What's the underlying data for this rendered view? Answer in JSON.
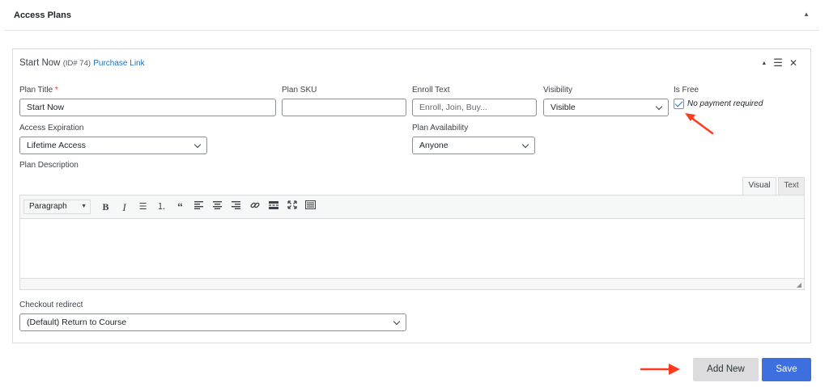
{
  "panel": {
    "title": "Access Plans"
  },
  "plan": {
    "name": "Start Now",
    "id_text": "(ID# 74)",
    "purchase_link": "Purchase Link"
  },
  "fields": {
    "plan_title": {
      "label": "Plan Title",
      "required_mark": "*",
      "value": "Start Now"
    },
    "plan_sku": {
      "label": "Plan SKU",
      "value": ""
    },
    "enroll_text": {
      "label": "Enroll Text",
      "placeholder": "Enroll, Join, Buy..."
    },
    "visibility": {
      "label": "Visibility",
      "value": "Visible"
    },
    "is_free": {
      "label": "Is Free",
      "checkbox_label": "No payment required",
      "checked": true
    },
    "access_expiration": {
      "label": "Access Expiration",
      "value": "Lifetime Access"
    },
    "plan_availability": {
      "label": "Plan Availability",
      "value": "Anyone"
    },
    "plan_description": {
      "label": "Plan Description"
    },
    "checkout_redirect": {
      "label": "Checkout redirect",
      "value": "(Default) Return to Course"
    }
  },
  "editor": {
    "tabs": {
      "visual": "Visual",
      "text": "Text"
    },
    "format_select": "Paragraph",
    "toolbar_icons": [
      "bold-icon",
      "italic-icon",
      "bullet-list-icon",
      "numbered-list-icon",
      "blockquote-icon",
      "align-left-icon",
      "align-center-icon",
      "align-right-icon",
      "link-icon",
      "read-more-icon",
      "fullscreen-icon",
      "toolbar-toggle-icon"
    ]
  },
  "buttons": {
    "add_new": "Add New",
    "save": "Save"
  },
  "colors": {
    "accent": "#3e6fde",
    "link": "#2271b1",
    "annotation_arrow": "#ff3b1f",
    "required": "#d63638"
  }
}
